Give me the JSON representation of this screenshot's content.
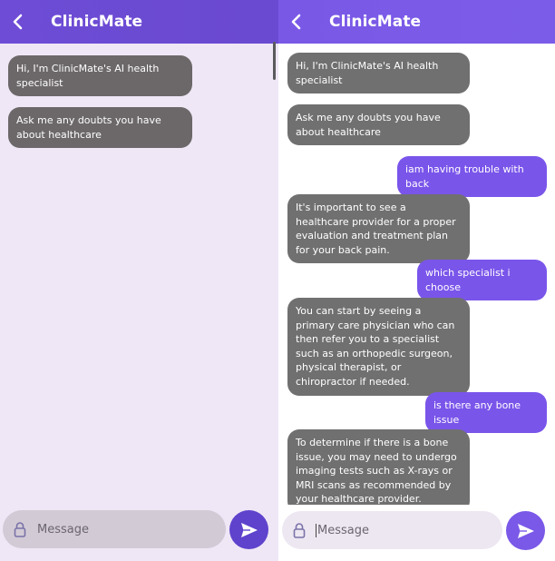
{
  "left": {
    "header": {
      "title": "ClinicMate"
    },
    "messages": [
      {
        "role": "bot",
        "text": "Hi, I'm ClinicMate's AI health specialist"
      },
      {
        "role": "bot",
        "text": "Ask me any doubts you have about healthcare"
      }
    ],
    "composer": {
      "placeholder": "Message"
    }
  },
  "right": {
    "header": {
      "title": "ClinicMate"
    },
    "messages": [
      {
        "role": "bot",
        "text": "Hi, I'm ClinicMate's AI health specialist"
      },
      {
        "role": "bot",
        "text": "Ask me any doubts you have about healthcare"
      },
      {
        "role": "user",
        "text": "iam having trouble with back"
      },
      {
        "role": "bot",
        "text": "It's important to see a healthcare provider for a proper evaluation and treatment plan for your back pain."
      },
      {
        "role": "user",
        "text": "which specialist i choose"
      },
      {
        "role": "bot",
        "text": "You can start by seeing a primary care physician who can then refer you to a specialist such as an orthopedic surgeon, physical therapist, or chiropractor if needed."
      },
      {
        "role": "user",
        "text": "is there any bone issue"
      },
      {
        "role": "bot",
        "text": "To determine if there is a bone issue, you may need to undergo imaging tests such as X-rays or MRI scans as recommended by your healthcare provider."
      }
    ],
    "composer": {
      "placeholder": "Message"
    }
  },
  "colors": {
    "header_purple": "#6e4cd6",
    "user_bubble": "#7a55ea",
    "bot_bubble": "#707070",
    "send_button": "#5f43cc"
  },
  "icons": {
    "back": "chevron-left-icon",
    "lock": "lock-icon",
    "send": "send-icon"
  }
}
